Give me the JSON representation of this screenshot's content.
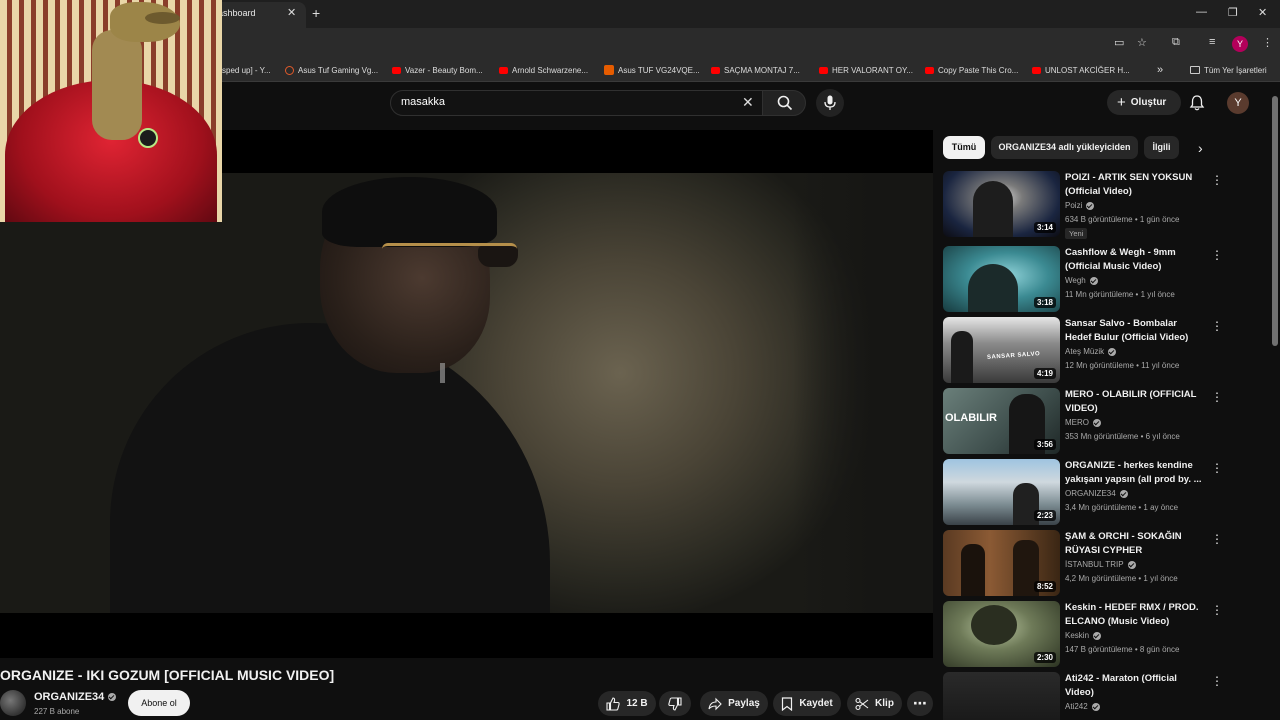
{
  "browser": {
    "tab_title": "ashboard",
    "bookmarks": [
      {
        "label": "sped up] - Y...",
        "icon": "none"
      },
      {
        "label": "Asus Tuf Gaming Vg...",
        "icon": "asus"
      },
      {
        "label": "Vazer - Beauty Bom...",
        "icon": "youtube"
      },
      {
        "label": "Arnold Schwarzene...",
        "icon": "youtube"
      },
      {
        "label": "Asus TUF VG24VQE...",
        "icon": "nb"
      },
      {
        "label": "SAÇMA MONTAJ 7...",
        "icon": "youtube"
      },
      {
        "label": "HER VALORANT OY...",
        "icon": "youtube"
      },
      {
        "label": "Copy Paste This Cro...",
        "icon": "youtube"
      },
      {
        "label": "UNLOST AKCİĞER H...",
        "icon": "youtube"
      }
    ],
    "all_bookmarks_label": "Tüm Yer İşaretleri",
    "profile_initial": "Y"
  },
  "header": {
    "search_value": "masakka",
    "create_label": "Oluştur",
    "avatar_initial": "Y"
  },
  "video": {
    "title": "ORGANIZE - IKI GOZUM [OFFICIAL MUSIC VIDEO]",
    "channel": "ORGANIZE34",
    "subscribers": "227 B abone",
    "subscribe_label": "Abone ol",
    "likes": "12 B",
    "share_label": "Paylaş",
    "save_label": "Kaydet",
    "clip_label": "Klip"
  },
  "chips": [
    "Tümü",
    "ORGANIZE34 adlı yükleyiciden",
    "İlgili"
  ],
  "recommendations": [
    {
      "title": "POIZI - ARTIK SEN YOKSUN (Official Video)",
      "channel": "Poizi",
      "meta": "634 B görüntüleme • 1 gün önce",
      "duration": "3:14",
      "badge": "Yeni"
    },
    {
      "title": "Cashflow & Wegh - 9mm (Official Music Video)",
      "channel": "Wegh",
      "meta": "11 Mn görüntüleme • 1 yıl önce",
      "duration": "3:18",
      "badge": ""
    },
    {
      "title": "Sansar Salvo - Bombalar Hedef Bulur (Official Video)",
      "channel": "Ateş Müzik",
      "meta": "12 Mn görüntüleme • 11 yıl önce",
      "duration": "4:19",
      "badge": ""
    },
    {
      "title": "MERO - OLABILIR (OFFICIAL VIDEO)",
      "channel": "MERO",
      "meta": "353 Mn görüntüleme • 6 yıl önce",
      "duration": "3:56",
      "badge": ""
    },
    {
      "title": "ORGANIZE - herkes kendine yakışanı yapsın (all prod by. ...",
      "channel": "ORGANIZE34",
      "meta": "3,4 Mn görüntüleme • 1 ay önce",
      "duration": "2:23",
      "badge": ""
    },
    {
      "title": "ŞAM & ORCHI - SOKAĞIN RÜYASI CYPHER",
      "channel": "İSTANBUL TRIP",
      "meta": "4,2 Mn görüntüleme • 1 yıl önce",
      "duration": "8:52",
      "badge": ""
    },
    {
      "title": "Keskin - HEDEF RMX / PROD. ELCANO (Music Video)",
      "channel": "Keskin",
      "meta": "147 B görüntüleme • 8 gün önce",
      "duration": "2:30",
      "badge": ""
    },
    {
      "title": "Ati242 - Maraton (Official Video)",
      "channel": "Ati242",
      "meta": "",
      "duration": "",
      "badge": ""
    }
  ],
  "thumbnail_text": {
    "sansar": "SANSAR SALVO",
    "mero": "OLABILIR"
  }
}
